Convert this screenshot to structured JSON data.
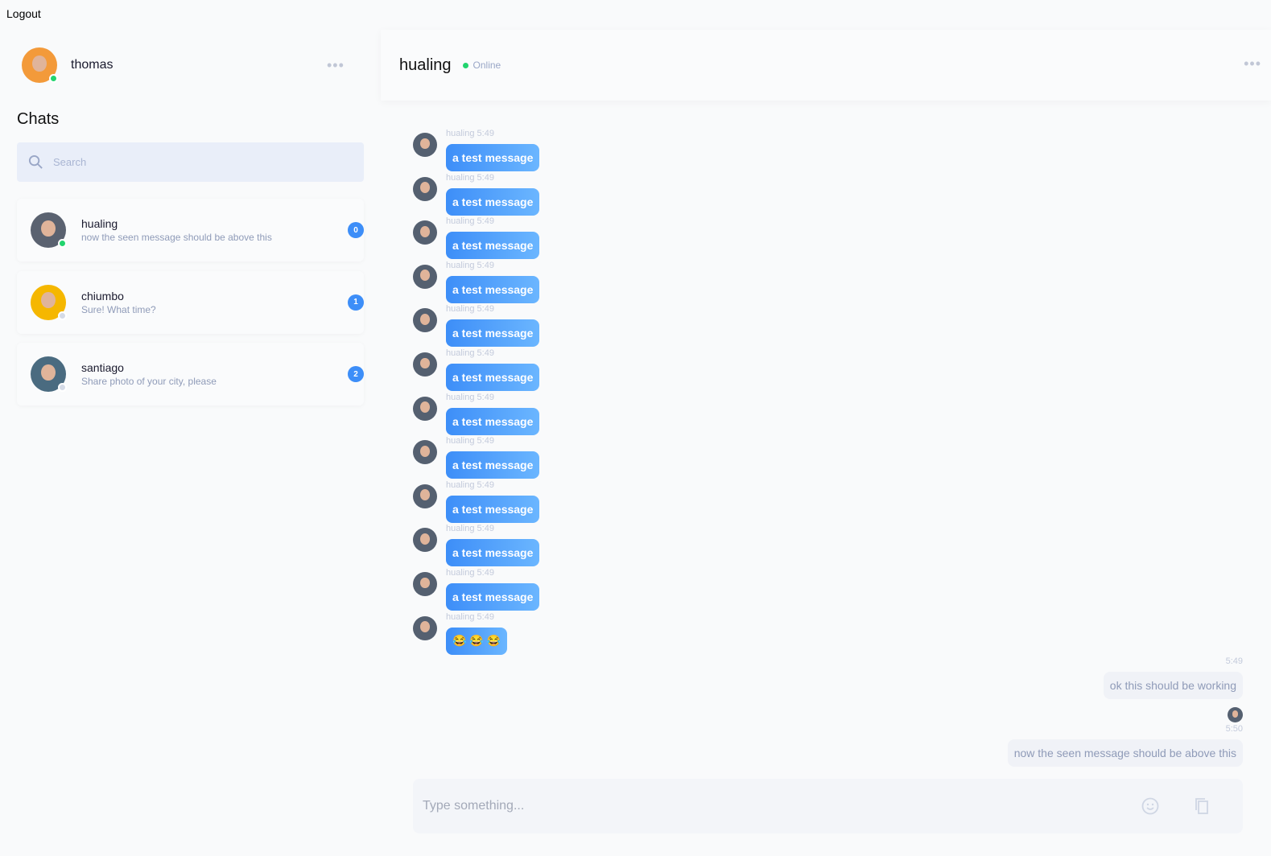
{
  "logout_label": "Logout",
  "user": {
    "name": "thomas",
    "status_color": "#22d46e"
  },
  "sidebar": {
    "title": "Chats",
    "search_placeholder": "Search",
    "chats": [
      {
        "name": "hualing",
        "preview": "now the seen message should be above this",
        "unread": "0",
        "online": true
      },
      {
        "name": "chiumbo",
        "preview": "Sure! What time?",
        "unread": "1",
        "online": false
      },
      {
        "name": "santiago",
        "preview": "Share photo of your city, please",
        "unread": "2",
        "online": false
      }
    ]
  },
  "header": {
    "title": "hualing",
    "status": "Online"
  },
  "messages_in": [
    {
      "meta": "hualing 5:49",
      "text": "a test message"
    },
    {
      "meta": "hualing 5:49",
      "text": "a test message"
    },
    {
      "meta": "hualing 5:49",
      "text": "a test message"
    },
    {
      "meta": "hualing 5:49",
      "text": "a test message"
    },
    {
      "meta": "hualing 5:49",
      "text": "a test message"
    },
    {
      "meta": "hualing 5:49",
      "text": "a test message"
    },
    {
      "meta": "hualing 5:49",
      "text": "a test message"
    },
    {
      "meta": "hualing 5:49",
      "text": "a test message"
    },
    {
      "meta": "hualing 5:49",
      "text": "a test message"
    },
    {
      "meta": "hualing 5:49",
      "text": "a test message"
    },
    {
      "meta": "hualing 5:49",
      "text": "a test message"
    },
    {
      "meta": "hualing 5:49",
      "text": "😂 😂 😂"
    }
  ],
  "messages_out": [
    {
      "time": "5:49",
      "text": "ok this should be working"
    },
    {
      "time": "5:50",
      "text": "now the seen message should be above this"
    }
  ],
  "composer": {
    "placeholder": "Type something..."
  },
  "colors": {
    "accent": "#3d8ef8",
    "online": "#22d46e",
    "offline": "#d5dbe7"
  }
}
